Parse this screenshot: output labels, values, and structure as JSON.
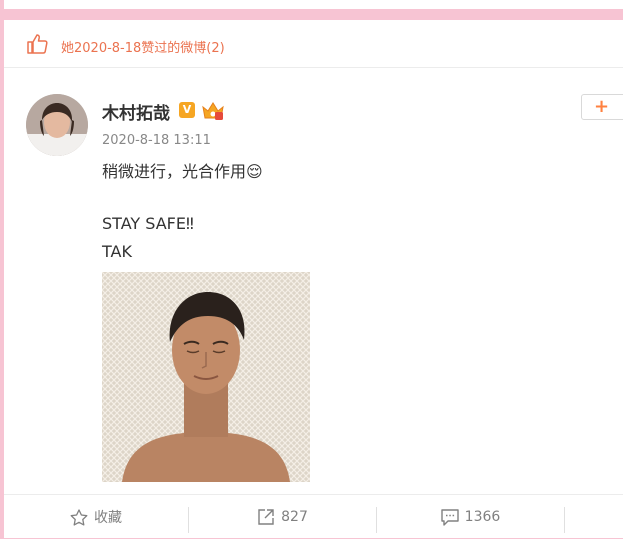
{
  "likes_header": {
    "text": "她2020-8-18赞过的微博(2)"
  },
  "post": {
    "author": "木村拓哉",
    "verified_badge": "V",
    "timestamp": "2020-8-18 13:11",
    "follow_label": "+",
    "lines": [
      "稍微进行，光合作用😌",
      "STAY SAFE‼",
      "TAK"
    ]
  },
  "actions": {
    "favorite_label": "收藏",
    "share_count": "827",
    "comment_count": "1366"
  },
  "colors": {
    "accent_orange": "#eb7350",
    "follow_orange": "#ff8140",
    "background_pink": "#f7c4d3"
  }
}
